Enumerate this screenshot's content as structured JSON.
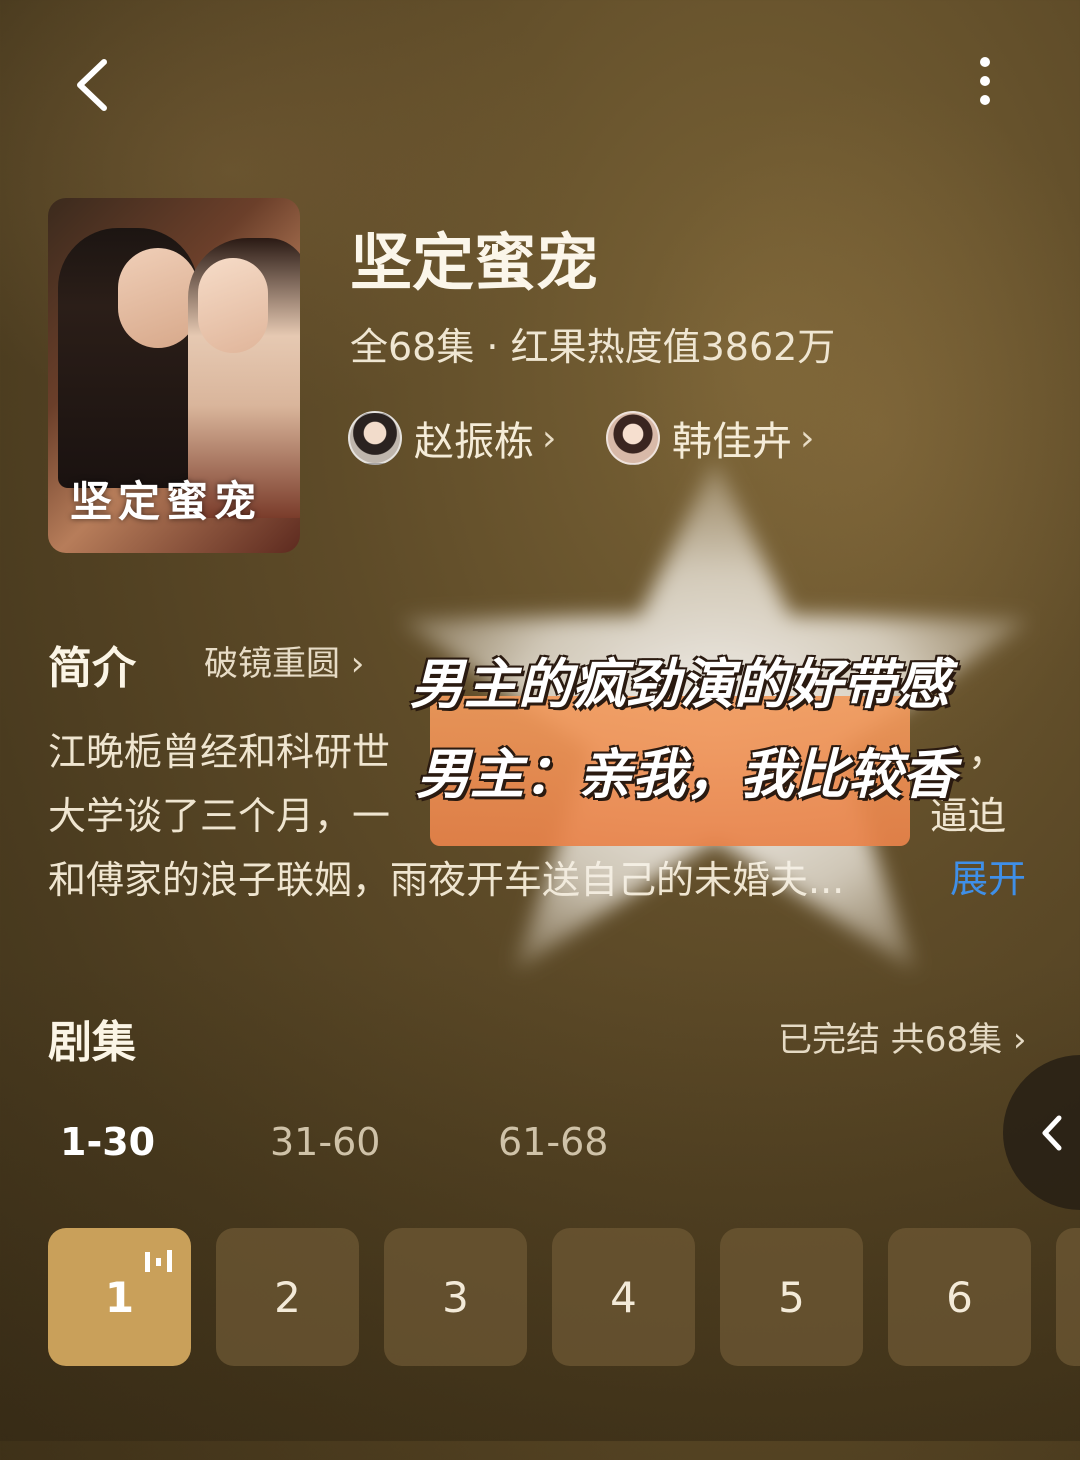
{
  "nav": {
    "back_icon": "chevron-left-icon",
    "more_icon": "more-vertical-icon"
  },
  "drama": {
    "title": "坚定蜜宠",
    "poster_title": "坚定蜜宠",
    "meta": "全68集 · 红果热度值3862万",
    "cast": [
      {
        "name": "赵振栋"
      },
      {
        "name": "韩佳卉"
      }
    ]
  },
  "intro": {
    "heading": "简介",
    "tag": "破镜重圆 ›",
    "lines": [
      "江晚栀曾经和科研世",
      "大学谈了三个月，一",
      "和傅家的浪子联姻，雨夜开车送自己的未婚夫..."
    ],
    "line1_tail": "，",
    "line2_tail": "逼迫",
    "expand": "展开"
  },
  "sticker": {
    "line1": "男主的疯劲演的好带感",
    "line2": "男主：亲我，我比较香"
  },
  "episodes": {
    "heading": "剧集",
    "status": "已完结 共68集 ›",
    "ranges": [
      "1-30",
      "31-60",
      "61-68"
    ],
    "active_range": "1-30",
    "items": [
      "1",
      "2",
      "3",
      "4",
      "5",
      "6"
    ],
    "current": "1"
  },
  "colors": {
    "accent_active_episode": "#c9a05a",
    "expand_link": "#3f8fe8",
    "sticker_orange": "#f19a5c"
  }
}
